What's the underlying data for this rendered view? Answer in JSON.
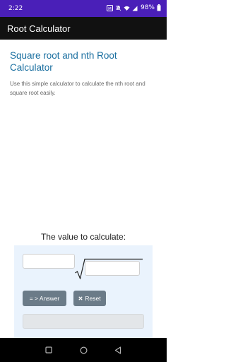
{
  "status_bar": {
    "time": "2:22",
    "battery": "98%",
    "icons": [
      "notification-icon",
      "mute-icon",
      "wifi-icon",
      "signal-icon",
      "battery-icon"
    ]
  },
  "app_bar": {
    "title": "Root Calculator"
  },
  "main": {
    "heading": "Square root and nth Root Calculator",
    "subtitle": "Use this simple calculator to calculate the nth root and square root easily.",
    "calc_label": "The value to calculate:",
    "answer_button": "= > Answer",
    "reset_button": "Reset",
    "reset_icon": "x-icon",
    "index_value": "",
    "radicand_value": "",
    "result_value": ""
  },
  "nav_bar": {
    "icons": [
      "recents-icon",
      "home-icon",
      "back-icon"
    ]
  },
  "colors": {
    "status_bar": "#4a1fb8",
    "app_bar": "#111111",
    "heading": "#1a6fa0",
    "panel": "#eaf3fd",
    "button": "#6b7b88"
  }
}
